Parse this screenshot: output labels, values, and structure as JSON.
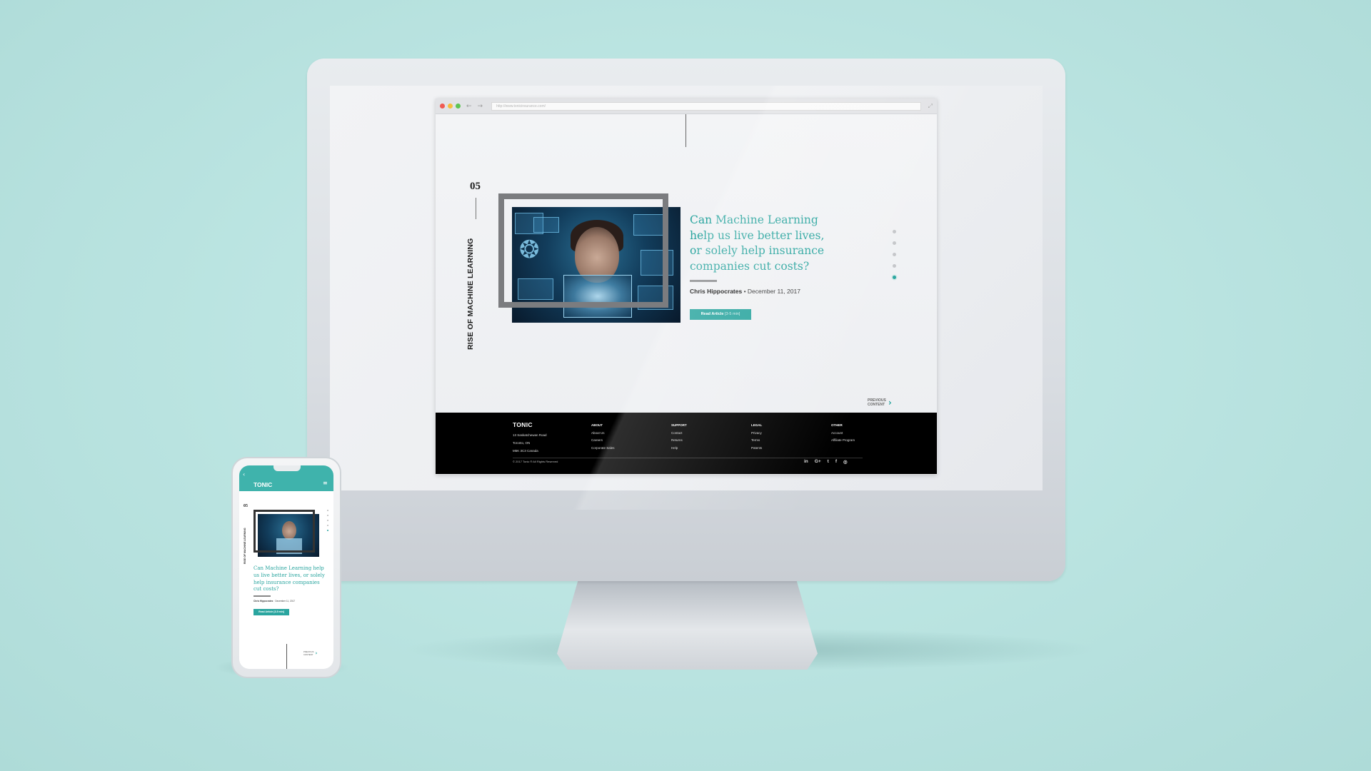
{
  "browser": {
    "url": "http://www.tonicinsurance.com/"
  },
  "article": {
    "number": "05",
    "category": "RISE OF MACHINE LEARNING",
    "headline": "Can Machine Learning help us live better lives, or solely help insurance companies cut costs?",
    "author": "Chris Hippocrates",
    "date": "December 11, 2017",
    "date_separator": " • ",
    "read_button_label": "Read Article",
    "read_time": "[3-5 min]"
  },
  "pager": {
    "count": 5,
    "active_index": 4
  },
  "prev_content": {
    "line1": "PREVIOUS",
    "line2": "CONTENT"
  },
  "footer": {
    "brand": "TONIC",
    "address": [
      "13 Saskatchewan Road",
      "Toronto, ON",
      "M5K 3C3 Canada"
    ],
    "columns": [
      {
        "heading": "ABOUT",
        "items": [
          "About Us",
          "Careers",
          "Corporate Sales"
        ]
      },
      {
        "heading": "SUPPORT",
        "items": [
          "Contact",
          "Returns",
          "Help"
        ]
      },
      {
        "heading": "LEGAL",
        "items": [
          "Privacy",
          "Terms",
          "Patents"
        ]
      },
      {
        "heading": "OTHER",
        "items": [
          "Account",
          "Affiliate Program"
        ]
      }
    ],
    "copyright": "© 2017 Tonic ® All Rights Reserved",
    "socials": [
      {
        "name": "linkedin-icon",
        "glyph": "in"
      },
      {
        "name": "google-plus-icon",
        "glyph": "G+"
      },
      {
        "name": "twitter-icon",
        "glyph": "t"
      },
      {
        "name": "facebook-icon",
        "glyph": "f"
      },
      {
        "name": "instagram-icon",
        "glyph": "◎"
      }
    ]
  },
  "mobile": {
    "brand": "TONIC",
    "number": "05",
    "category": "RISE OF MACHINE LEARNING",
    "headline": "Can Machine Learning help us live better lives, or solely help insurance companies cut costs?",
    "author": "Chris Hippocrates",
    "date": "December 11, 2017",
    "read_button_label": "Read Article",
    "read_time": "[3-5 min]",
    "prev_line1": "PREVIOUS",
    "prev_line2": "CONTENT"
  },
  "colors": {
    "accent": "#2aa59f",
    "background": "#b9e3e0",
    "footer": "#000000"
  }
}
